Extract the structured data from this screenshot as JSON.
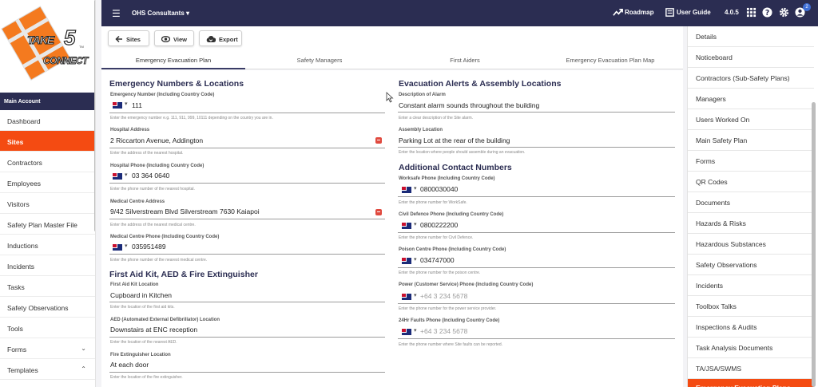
{
  "logo": {
    "take": "TAKE",
    "five": "5",
    "connect": "CONNECT",
    "tm": "TM"
  },
  "sidebar": {
    "account_header": "Main Account",
    "items": [
      {
        "label": "Dashboard"
      },
      {
        "label": "Sites",
        "active": true
      },
      {
        "label": "Contractors"
      },
      {
        "label": "Employees"
      },
      {
        "label": "Visitors"
      },
      {
        "label": "Safety Plan Master File"
      },
      {
        "label": "Inductions"
      },
      {
        "label": "Incidents"
      },
      {
        "label": "Tasks"
      },
      {
        "label": "Safety Observations"
      },
      {
        "label": "Tools"
      },
      {
        "label": "Forms",
        "chevron": "chevron-down-icon"
      },
      {
        "label": "Templates",
        "chevron": "chevron-up-icon"
      }
    ]
  },
  "topbar": {
    "org": "OHS Consultants",
    "roadmap": "Roadmap",
    "user_guide": "User Guide",
    "version": "4.0.5",
    "notification_count": "2"
  },
  "toolbar": {
    "sites": "Sites",
    "view": "View",
    "export": "Export"
  },
  "tabs": [
    {
      "label": "Emergency Evacuation Plan",
      "active": true
    },
    {
      "label": "Safety Managers"
    },
    {
      "label": "First Aiders"
    },
    {
      "label": "Emergency Evacuation Plan Map"
    }
  ],
  "left_col": {
    "heading1": "Emergency Numbers & Locations",
    "emergency": {
      "label": "Emergency Number (Including Country Code)",
      "value": "111",
      "hint": "Enter the emergency number e.g. 111, 911, 999, 10111 depending on the country you are in."
    },
    "hospital_address": {
      "label": "Hospital Address",
      "value": "2 Riccarton Avenue, Addington",
      "hint": "Enter the address of the nearest hospital."
    },
    "hospital_phone": {
      "label": "Hospital Phone (Including Country Code)",
      "value": "03 364 0640",
      "hint": "Enter the phone number of the nearest hospital."
    },
    "medical_address": {
      "label": "Medical Centre Address",
      "value": "9/42 Silverstream Blvd  Silverstream   7630  Kaiapoi",
      "hint": "Enter the address of the nearest medical centre."
    },
    "medical_phone": {
      "label": "Medical Centre Phone (Including Country Code)",
      "value": "035951489",
      "hint": "Enter the phone number of the nearest medical centre."
    },
    "heading2": "First Aid Kit, AED & Fire Extinguisher",
    "first_aid": {
      "label": "First Aid Kit Location",
      "value": "Cupboard in Kitchen",
      "hint": "Enter the location of the first aid kits."
    },
    "aed": {
      "label": "AED (Automated External Defibrillator) Location",
      "value": "Downstairs at ENC reception",
      "hint": "Enter the location of the nearest AED."
    },
    "fire": {
      "label": "Fire Extinguisher Location",
      "value": "At each door",
      "hint": "Enter the location of the fire extinguisher."
    }
  },
  "right_col": {
    "heading1": "Evacuation Alerts & Assembly Locations",
    "alarm": {
      "label": "Description of Alarm",
      "value": "Constant alarm sounds throughout the building",
      "hint": "Enter a clear description of the Site alarm."
    },
    "assembly": {
      "label": "Assembly Location",
      "value": "Parking Lot at the rear of the building",
      "hint": "Enter the location where people should assemble during an evacuation."
    },
    "heading2": "Additional Contact Numbers",
    "worksafe": {
      "label": "Worksafe Phone (Including Country Code)",
      "value": "0800030040",
      "hint": "Enter the phone number for WorkSafe."
    },
    "civil": {
      "label": "Civil Defence Phone (Including Country Code)",
      "value": "0800222200",
      "hint": "Enter the phone number for Civil Defence."
    },
    "poison": {
      "label": "Poison Centre Phone (Including Country Code)",
      "value": "034747000",
      "hint": "Enter the phone number for the poison centre."
    },
    "power": {
      "label": "Power (Customer Service) Phone (Including Country Code)",
      "placeholder": "+64 3 234 5678",
      "hint": "Enter the phone number for the power service provider."
    },
    "faults": {
      "label": "24Hr Faults Phone (Including Country Code)",
      "placeholder": "+64 3 234 5678",
      "hint": "Enter the phone number where Site faults can be reported."
    }
  },
  "right_panel": {
    "items": [
      {
        "label": "Details"
      },
      {
        "label": "Noticeboard"
      },
      {
        "label": "Contractors (Sub-Safety Plans)"
      },
      {
        "label": "Managers"
      },
      {
        "label": "Users Worked On"
      },
      {
        "label": "Main Safety Plan"
      },
      {
        "label": "Forms"
      },
      {
        "label": "QR Codes"
      },
      {
        "label": "Documents"
      },
      {
        "label": "Hazards & Risks"
      },
      {
        "label": "Hazardous Substances"
      },
      {
        "label": "Safety Observations"
      },
      {
        "label": "Incidents"
      },
      {
        "label": "Toolbox Talks"
      },
      {
        "label": "Inspections & Audits"
      },
      {
        "label": "Task Analysis Documents"
      },
      {
        "label": "TA/JSA/SWMS"
      },
      {
        "label": "Emergency Evacuation Plans",
        "active": true
      }
    ]
  },
  "colors": {
    "navy": "#2b2d52",
    "accent": "#f44b12",
    "blue_badge": "#3f6fd8"
  }
}
